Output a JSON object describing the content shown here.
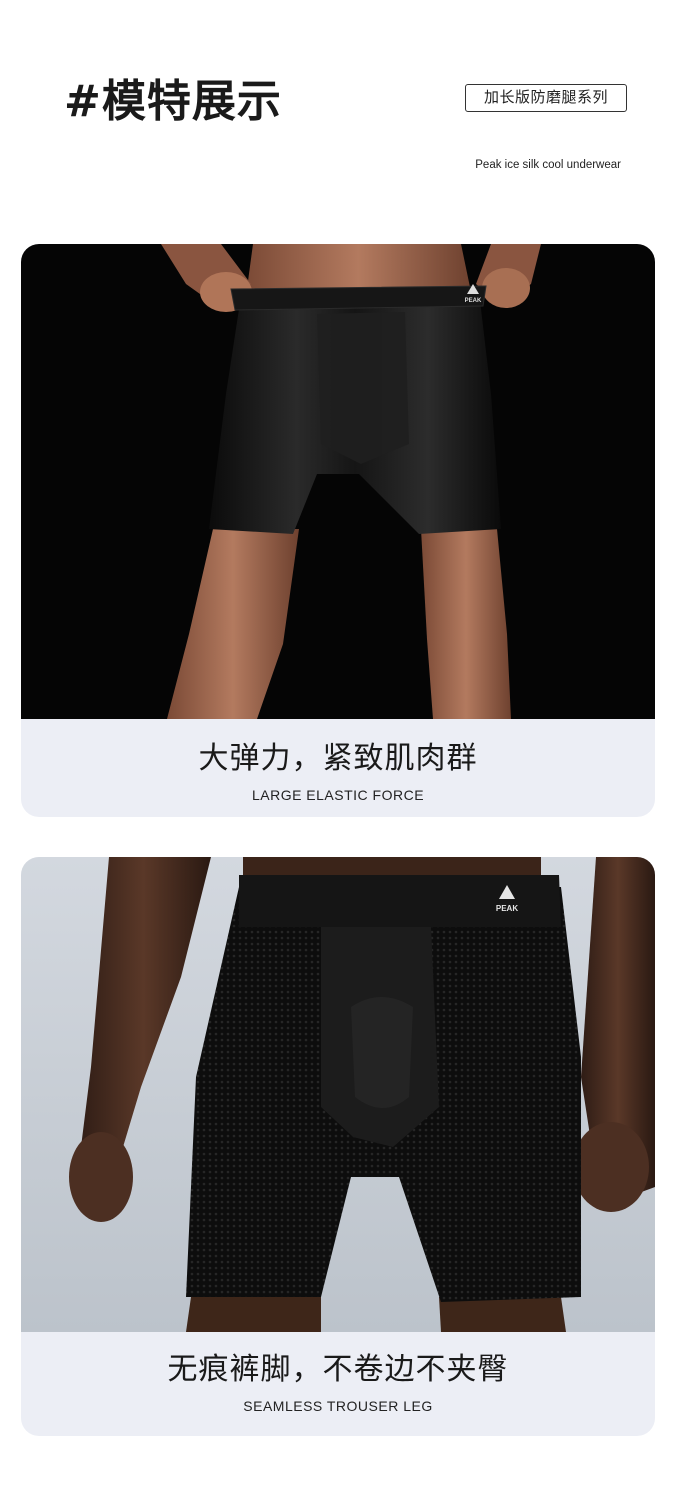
{
  "header": {
    "title": "#模特展示",
    "series_tag": "加长版防磨腿系列",
    "subtitle": "Peak ice silk cool underwear"
  },
  "cards": [
    {
      "caption_cn": "大弹力，紧致肌肉群",
      "caption_en": "LARGE ELASTIC FORCE",
      "logo": "PEAK"
    },
    {
      "caption_cn": "无痕裤脚，不卷边不夹臀",
      "caption_en": "SEAMLESS TROUSER LEG",
      "logo": "PEAK"
    }
  ],
  "colors": {
    "caption_panel": "#eceef5",
    "photo1_background": "#050505",
    "photo2_background": "#c9cfd6",
    "garment": "#111111",
    "skin_light": "#a8705a",
    "skin_dark": "#4a2e22"
  }
}
